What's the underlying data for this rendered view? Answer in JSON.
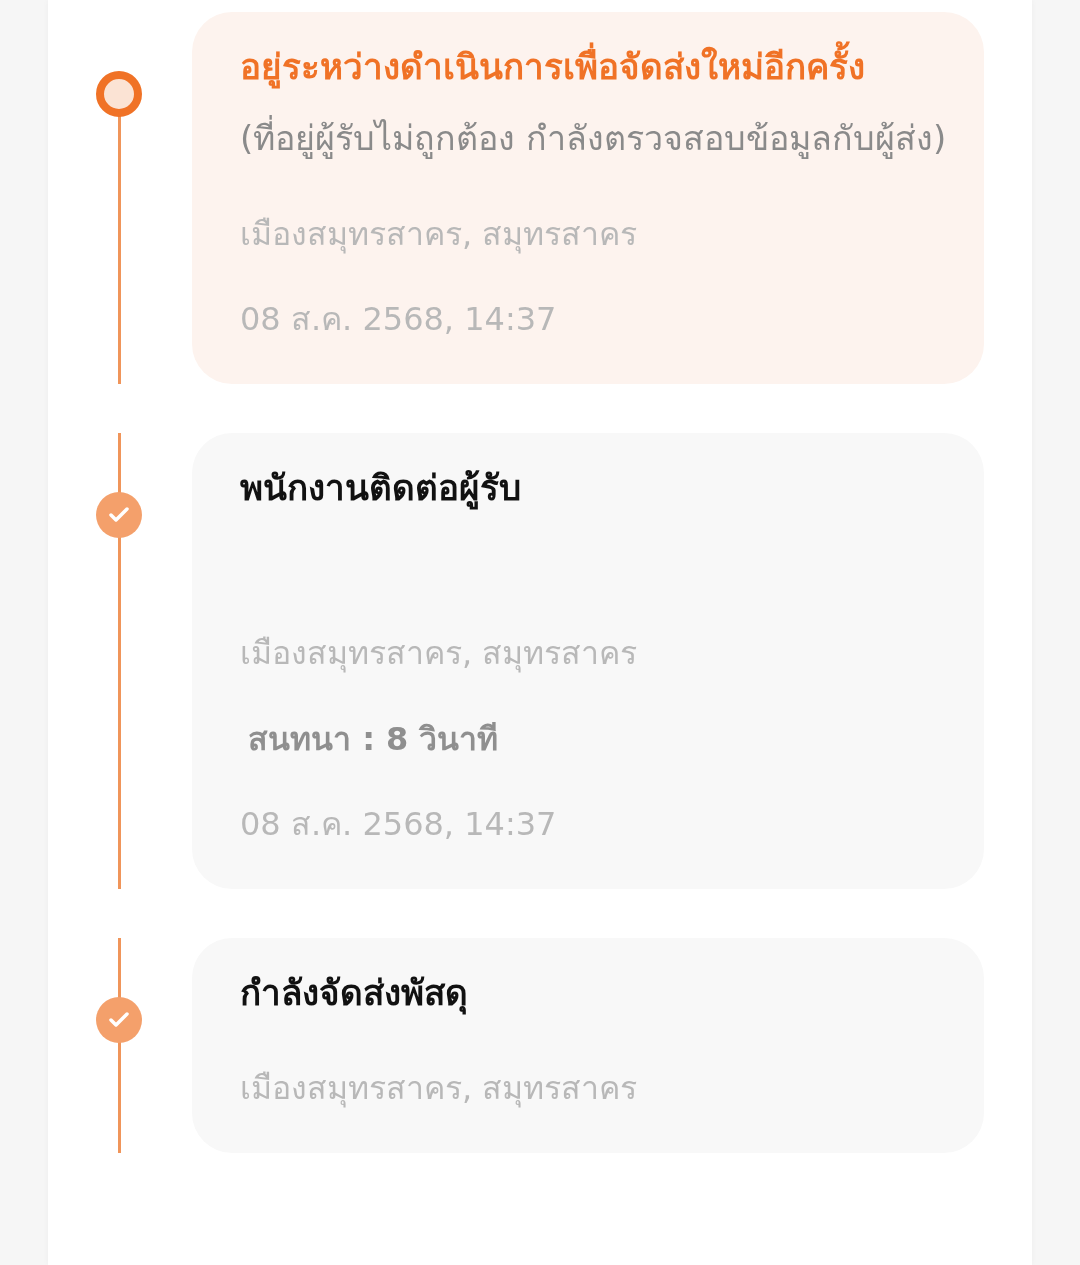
{
  "events": [
    {
      "title": "อยู่ระหว่างดำเนินการเพื่อจัดส่งใหม่อีกครั้ง",
      "note": "(ที่อยู่ผู้รับไม่ถูกต้อง กำลังตรวจสอบข้อมูลกับผู้ส่ง)",
      "location": "เมืองสมุทรสาคร, สมุทรสาคร",
      "time": "08 ส.ค. 2568, 14:37",
      "current": true
    },
    {
      "title": "พนักงานติดต่อผู้รับ",
      "location": "เมืองสมุทรสาคร, สมุทรสาคร",
      "call": "สนทนา : 8 วินาที",
      "time": "08 ส.ค. 2568, 14:37",
      "current": false
    },
    {
      "title": "กำลังจัดส่งพัสดุ",
      "location": "เมืองสมุทรสาคร, สมุทรสาคร",
      "current": false
    }
  ]
}
